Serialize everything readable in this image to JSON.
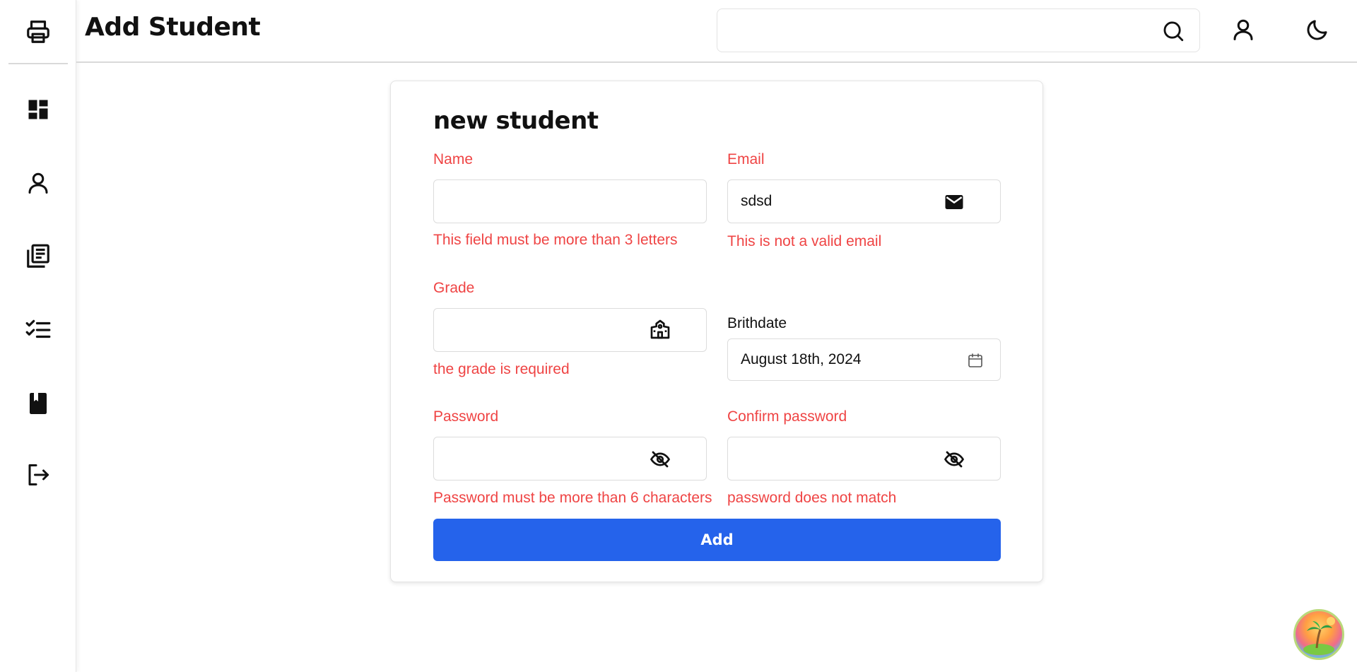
{
  "header": {
    "title": "Add Student",
    "search_value": "",
    "search_placeholder": ""
  },
  "sidebar": {
    "items": [
      {
        "name": "dashboard",
        "icon": "dashboard-icon"
      },
      {
        "name": "students",
        "icon": "user-icon"
      },
      {
        "name": "library",
        "icon": "library-books-icon"
      },
      {
        "name": "tasks",
        "icon": "checklist-icon"
      },
      {
        "name": "book",
        "icon": "book-icon"
      },
      {
        "name": "logout",
        "icon": "logout-icon"
      }
    ]
  },
  "form": {
    "title": "new student",
    "name": {
      "label": "Name",
      "value": "",
      "error": "This field must be more than 3 letters"
    },
    "email": {
      "label": "Email",
      "value": "sdsd",
      "error": "This is not a valid email"
    },
    "grade": {
      "label": "Grade",
      "value": "",
      "error": "the grade is required"
    },
    "birthdate": {
      "label": "Brithdate",
      "value": "August 18th, 2024"
    },
    "password": {
      "label": "Password",
      "value": "",
      "error": "Password must be more than 6 characters"
    },
    "confirm_password": {
      "label": "Confirm password",
      "value": "",
      "error": "password does not match"
    },
    "submit_label": "Add"
  },
  "colors": {
    "accent": "#2563eb",
    "error": "#ef4444",
    "text": "#111111",
    "border": "#dcdcdc"
  }
}
